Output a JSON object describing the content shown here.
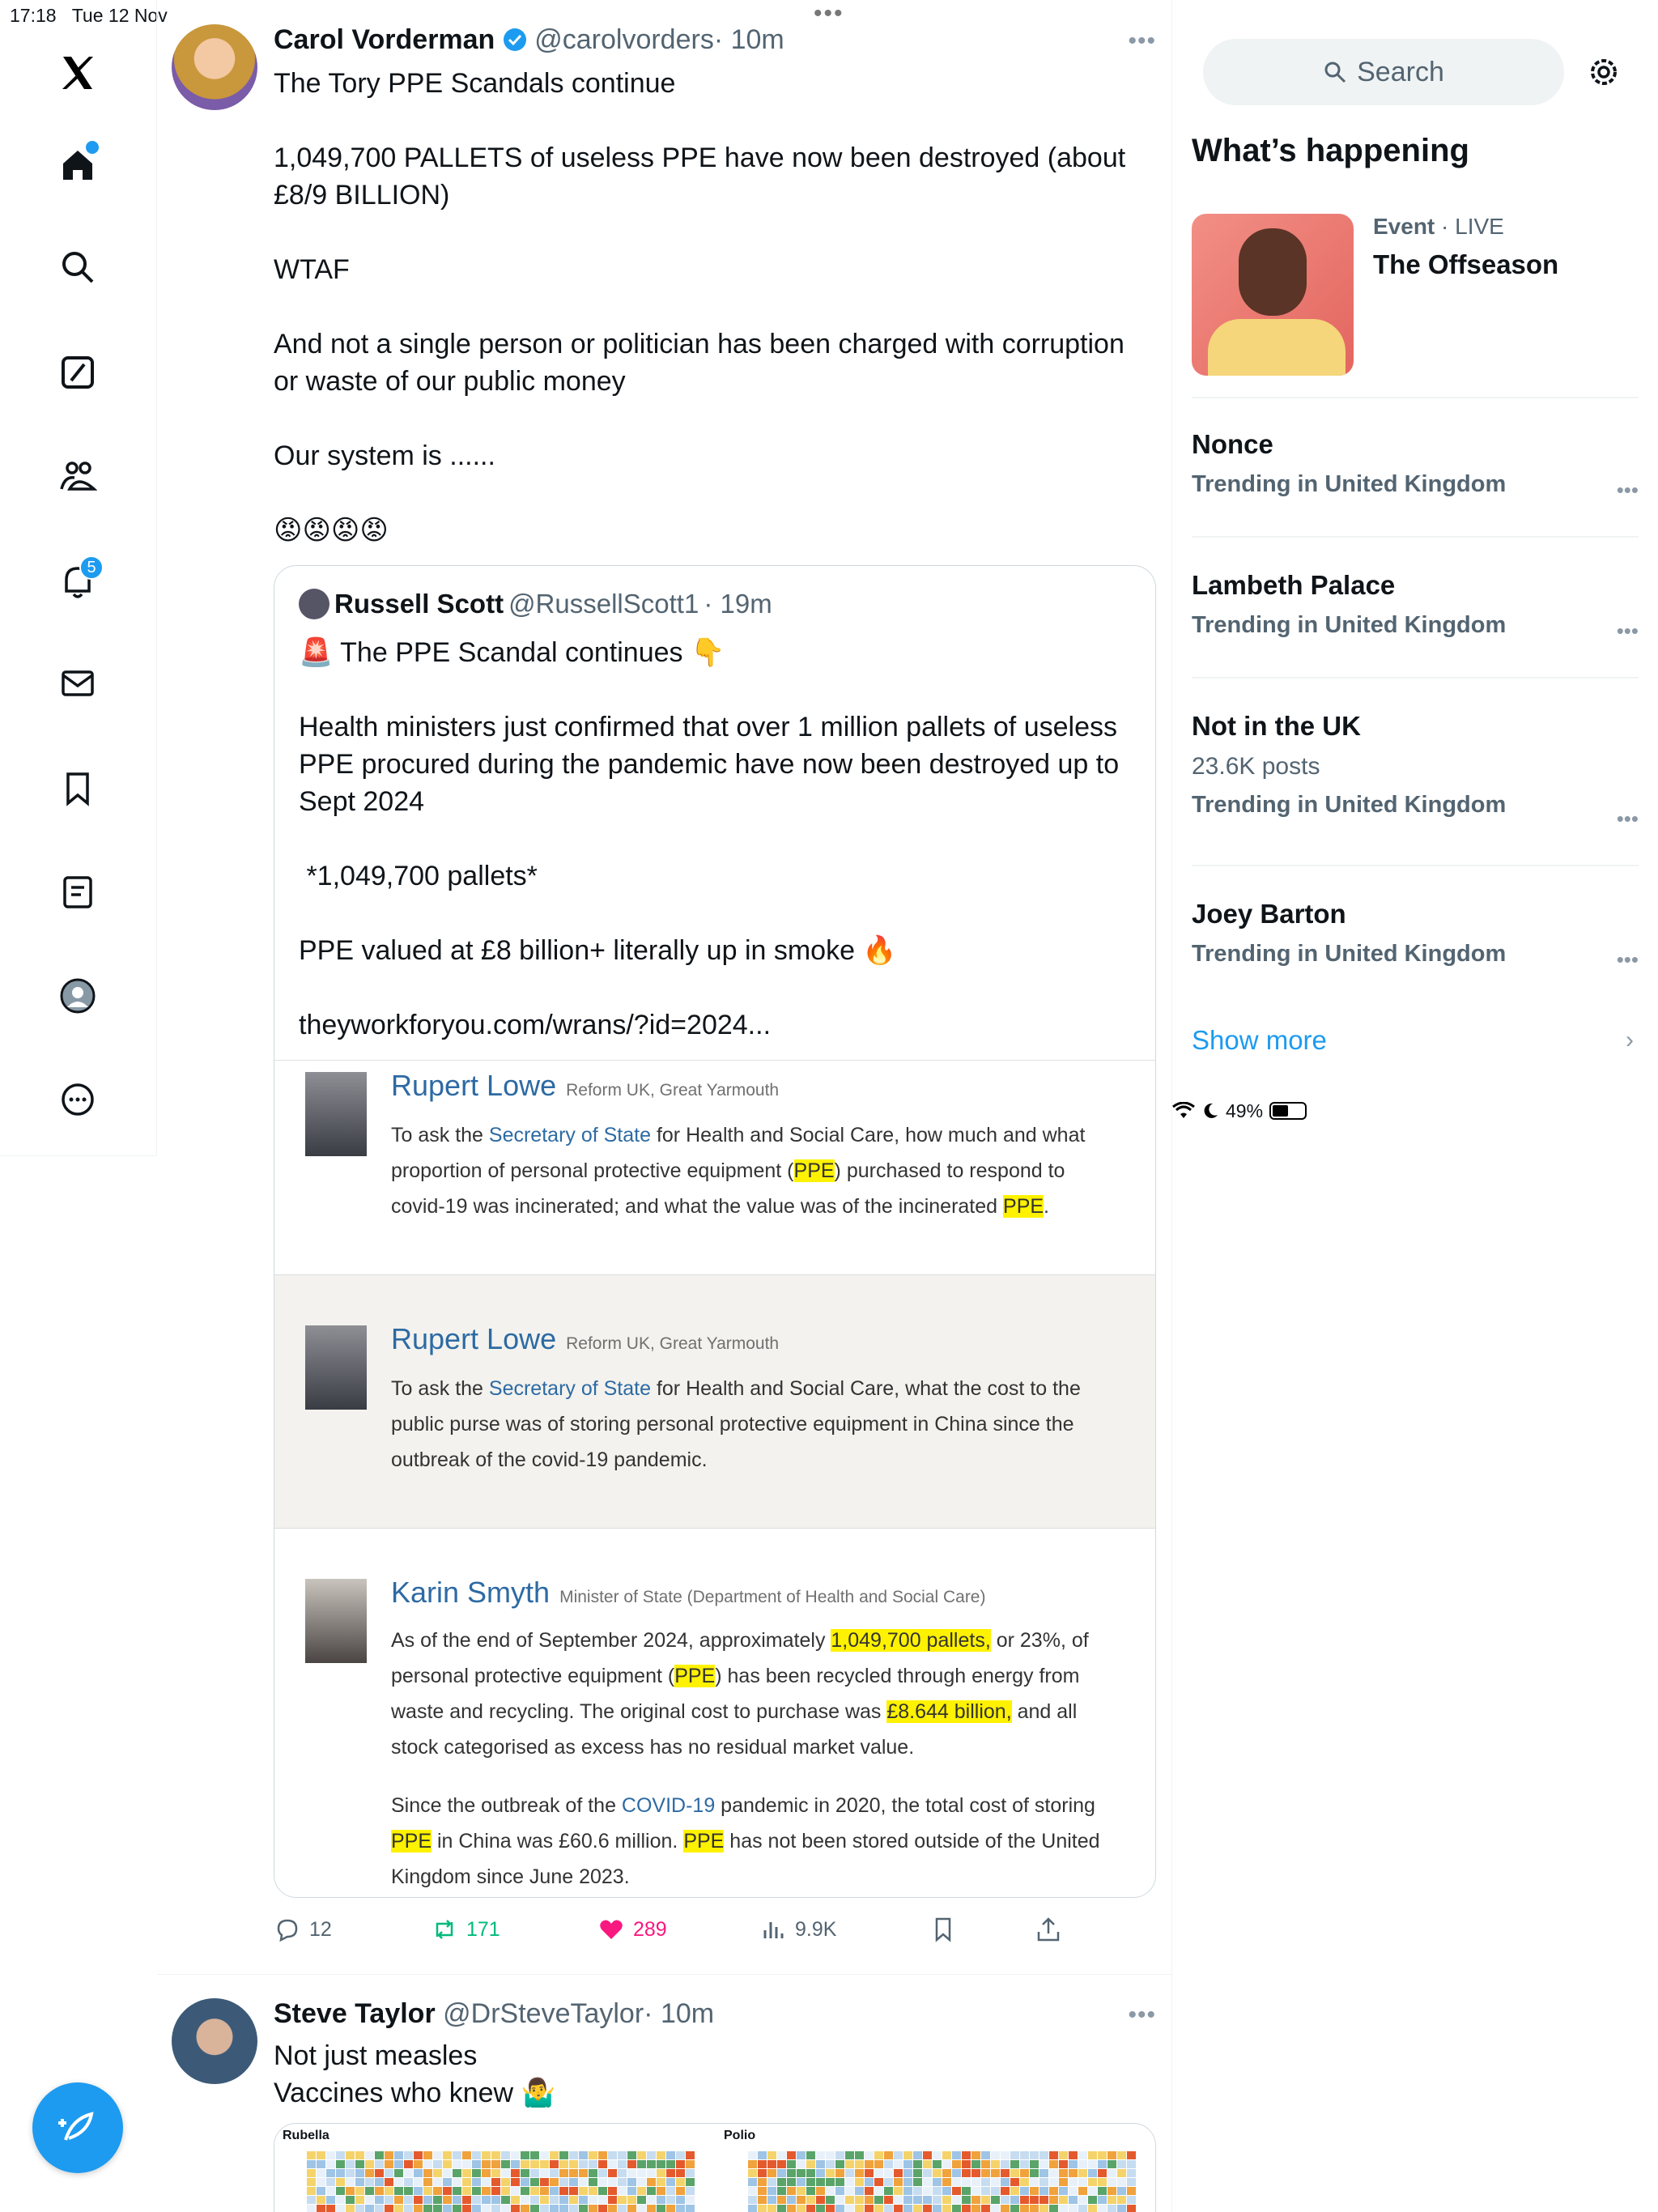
{
  "status_bar": {
    "time": "17:18",
    "date": "Tue 12 Nov",
    "battery": "49%",
    "battery_level": 0.49
  },
  "nav": {
    "logo": "x-logo-icon",
    "items": [
      "home-icon",
      "explore-icon",
      "grok-icon",
      "communities-icon",
      "notifications-icon",
      "messages-icon",
      "bookmarks-icon",
      "lists-icon",
      "profile-icon",
      "more-icon"
    ],
    "notifications_badge": "5"
  },
  "tweet1": {
    "name": "Carol Vorderman",
    "handle": "@carolvorders",
    "time": "· 10m",
    "text": "The Tory PPE Scandals continue\n\n1,049,700 PALLETS of useless PPE have now been destroyed (about £8/9 BILLION)\n\nWTAF\n\nAnd not a single person or politician has been charged with corruption or waste of our public money\n\nOur system is ......\n\n😡😡😡😡",
    "quote": {
      "name": "Russell Scott",
      "handle": "@RussellScott1",
      "time": "· 19m",
      "text": "🚨 The PPE Scandal continues 👇\n\nHealth ministers just confirmed that over 1 million pallets of useless PPE procured during the pandemic have now been destroyed up to Sept 2024\n\n *1,049,700 pallets*\n\nPPE valued at £8 billion+ literally up in smoke 🔥\n\ntheyworkforyou.com/wrans/?id=2024...",
      "image": {
        "q1_name": "Rupert Lowe",
        "q1_role": "Reform UK, Great Yarmouth",
        "q1_a": "To ask the ",
        "q1_link": "Secretary of State",
        "q1_b": " for Health and Social Care, how much and what proportion of personal protective equipment (",
        "q1_hl1": "PPE",
        "q1_c": ") purchased to respond to covid-19 was incinerated; and what the value was of the incinerated ",
        "q1_hl2": "PPE",
        "q1_d": ".",
        "q2_name": "Rupert Lowe",
        "q2_role": "Reform UK, Great Yarmouth",
        "q2_a": "To ask the ",
        "q2_link": "Secretary of State",
        "q2_b": " for Health and Social Care, what the cost to the public purse was of storing personal protective equipment in China since the outbreak of the covid-19 pandemic.",
        "a_name": "Karin Smyth",
        "a_role": "Minister of State (Department of Health and Social Care)",
        "a1_a": "As of the end of September 2024, approximately ",
        "a1_hl1": "1,049,700 pallets,",
        "a1_b": " or 23%, of personal protective equipment (",
        "a1_hl2": "PPE",
        "a1_c": ") has been recycled through energy from waste and recycling. The original cost to purchase was ",
        "a1_hl3": "£8.644 billion,",
        "a1_d": " and all stock categorised as excess has no residual market value.",
        "a2_a": "Since the outbreak of the ",
        "a2_link": "COVID-19",
        "a2_b": " pandemic in 2020, the total cost of storing ",
        "a2_hl1": "PPE",
        "a2_c": " in China was £60.6 million. ",
        "a2_hl2": "PPE",
        "a2_d": " has not been stored outside of the United Kingdom since June 2023."
      }
    },
    "actions": {
      "replies": "12",
      "reposts": "171",
      "likes": "289",
      "views": "9.9K"
    }
  },
  "tweet2": {
    "name": "Steve Taylor",
    "handle": "@DrSteveTaylor",
    "time": "· 10m",
    "text": "Not just measles\nVaccines who knew 🤷‍♂️",
    "chart_left_label": "Rubella",
    "chart_right_label": "Polio"
  },
  "sidebar": {
    "search_placeholder": "Search",
    "title": "What’s happening",
    "event": {
      "category": "Event",
      "live": " · LIVE",
      "title": "The Offseason"
    },
    "trends": [
      {
        "name": "Nonce",
        "posts": "",
        "context": "Trending in United Kingdom"
      },
      {
        "name": "Lambeth Palace",
        "posts": "",
        "context": "Trending in United Kingdom"
      },
      {
        "name": "Not in the UK",
        "posts": "23.6K posts",
        "context": "Trending in United Kingdom"
      },
      {
        "name": "Joey Barton",
        "posts": "",
        "context": "Trending in United Kingdom"
      }
    ],
    "show_more": "Show more"
  },
  "colors": {
    "accent": "#1d9bf0",
    "like": "#f91880",
    "repost": "#00ba7c",
    "highlight": "#fff200",
    "hansard_link": "#2d6aa3"
  }
}
